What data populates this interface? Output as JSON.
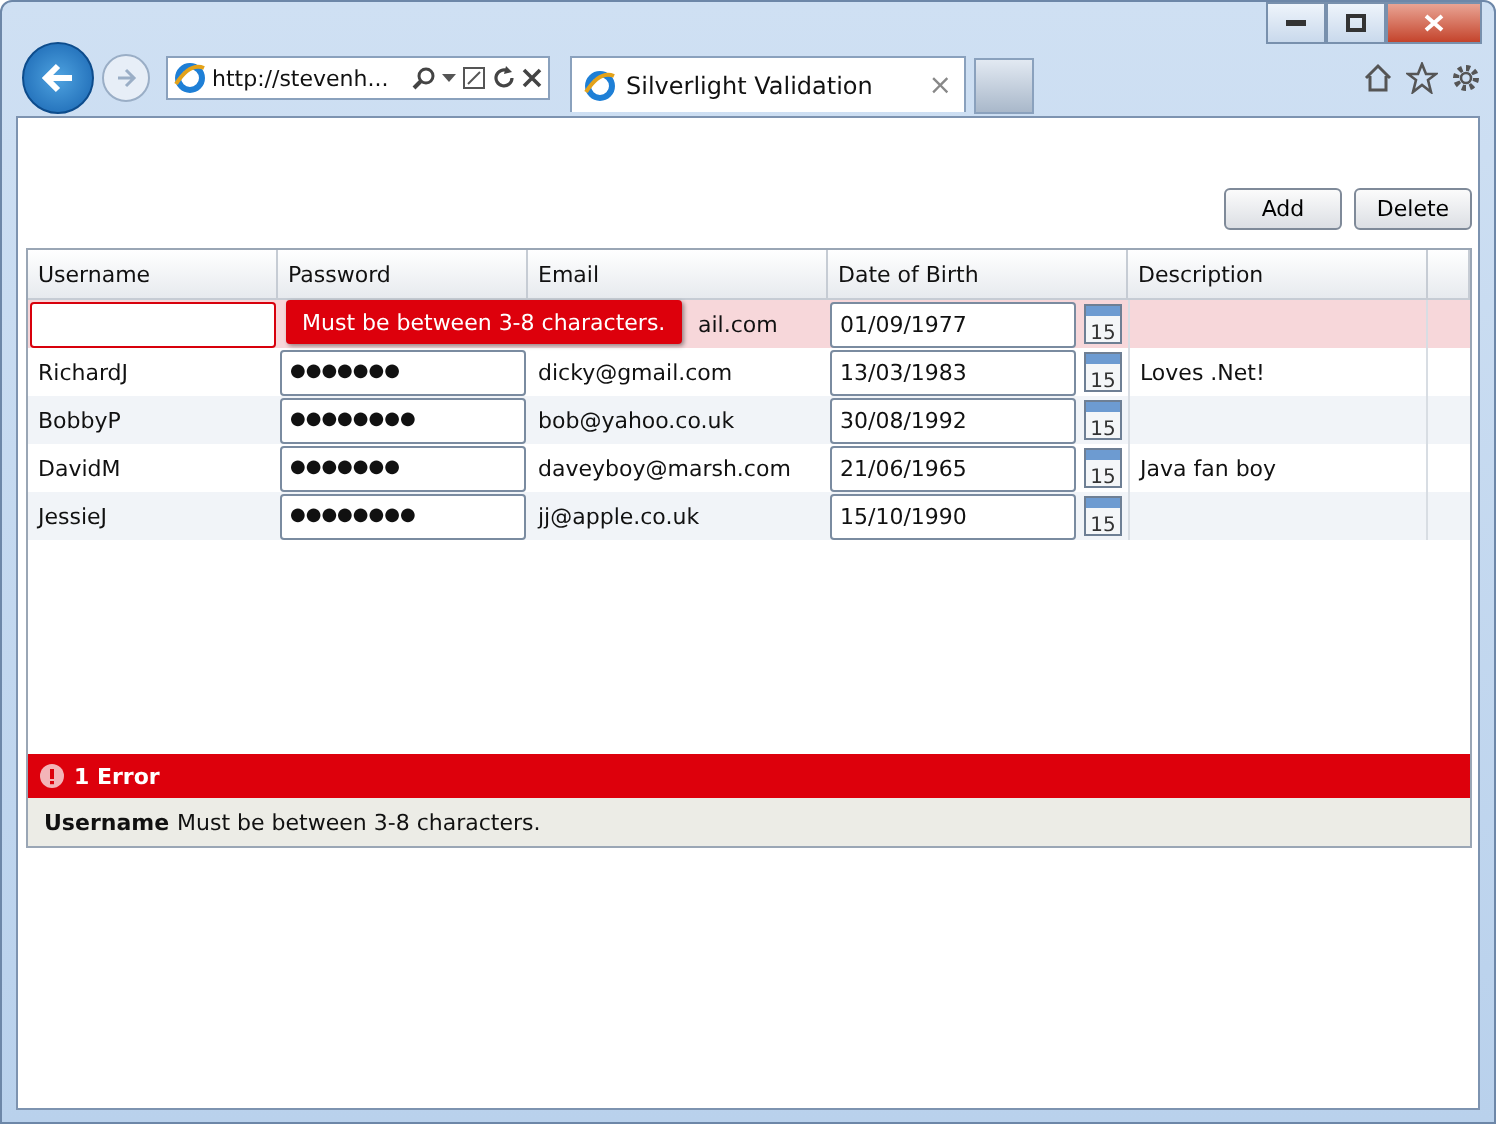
{
  "browser": {
    "address": "http://stevenh...",
    "tab": {
      "title": "Silverlight Validation",
      "close": "×"
    }
  },
  "toolbar": {
    "buttons": [
      "Add",
      "Delete"
    ]
  },
  "grid": {
    "columns": [
      "Username",
      "Password",
      "Email",
      "Date of Birth",
      "Description"
    ],
    "rows": [
      {
        "username": "",
        "password": "",
        "email": "ail.com",
        "dob": "01/09/1977",
        "calendar_day": "15",
        "description": "",
        "invalid": true
      },
      {
        "username": "RichardJ",
        "password": "●●●●●●●",
        "email": "dicky@gmail.com",
        "dob": "13/03/1983",
        "calendar_day": "15",
        "description": "Loves .Net!",
        "invalid": false
      },
      {
        "username": "BobbyP",
        "password": "●●●●●●●●",
        "email": "bob@yahoo.co.uk",
        "dob": "30/08/1992",
        "calendar_day": "15",
        "description": "",
        "invalid": false
      },
      {
        "username": "DavidM",
        "password": "●●●●●●●",
        "email": "daveyboy@marsh.com",
        "dob": "21/06/1965",
        "calendar_day": "15",
        "description": "Java fan boy",
        "invalid": false
      },
      {
        "username": "JessieJ",
        "password": "●●●●●●●●",
        "email": "jj@apple.co.uk",
        "dob": "15/10/1990",
        "calendar_day": "15",
        "description": "",
        "invalid": false
      }
    ],
    "tooltip": "Must be between 3-8 characters."
  },
  "errors": {
    "title": "1 Error",
    "items": [
      {
        "field": "Username",
        "message": "Must be between 3-8 characters."
      }
    ]
  }
}
